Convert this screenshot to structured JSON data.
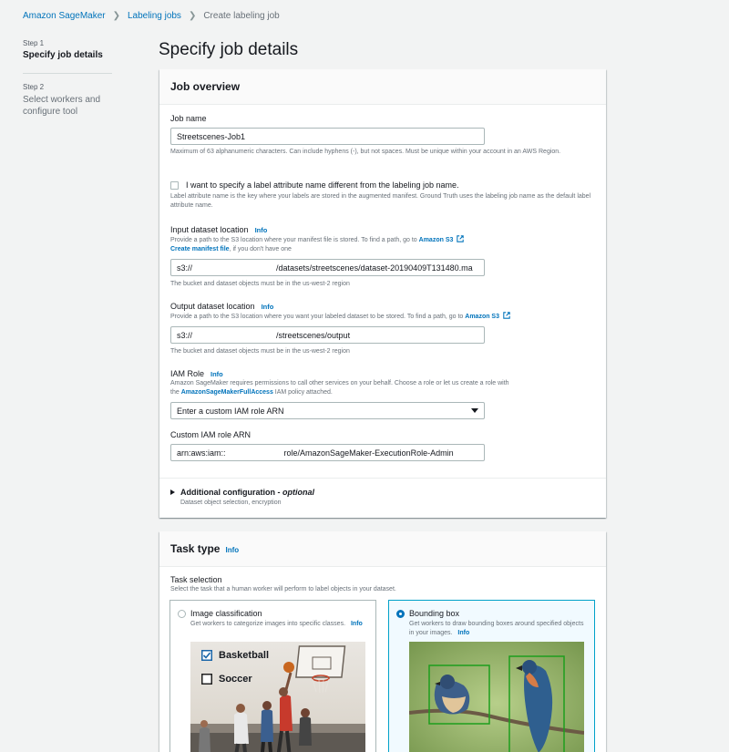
{
  "breadcrumb": {
    "item1": "Amazon SageMaker",
    "item2": "Labeling jobs",
    "current": "Create labeling job"
  },
  "steps": [
    {
      "label": "Step 1",
      "title": "Specify job details"
    },
    {
      "label": "Step 2",
      "title": "Select workers and configure tool"
    }
  ],
  "page_title": "Specify job details",
  "job_overview": {
    "title": "Job overview",
    "job_name": {
      "label": "Job name",
      "value": "Streetscenes-Job1",
      "hint": "Maximum of 63 alphanumeric characters. Can include hyphens (-), but not spaces. Must be unique within your account in an AWS Region."
    },
    "label_attr": {
      "label": "I want to specify a label attribute name different from the labeling job name.",
      "hint": "Label attribute name is the key where your labels are stored in the augmented manifest. Ground Truth uses the labeling job name as the default label attribute name."
    },
    "input": {
      "label": "Input dataset location",
      "info": "Info",
      "desc_prefix": "Provide a path to the S3 location where your manifest file is stored. To find a path, go to",
      "desc_link": "Amazon S3",
      "manifest_link": "Create manifest file",
      "manifest_suffix": ", if you don't have one",
      "value_prefix": "s3://",
      "value_suffix": "/datasets/streetscenes/dataset-20190409T131480.ma",
      "hint": "The bucket and dataset objects must be in the us-west-2 region"
    },
    "output": {
      "label": "Output dataset location",
      "info": "Info",
      "desc_prefix": "Provide a path to the S3 location where you want your labeled dataset to be stored. To find a path, go to",
      "desc_link": "Amazon S3",
      "value_prefix": "s3://",
      "value_suffix": "/streetscenes/output",
      "hint": "The bucket and dataset objects must be in the us-west-2 region"
    },
    "iam": {
      "label": "IAM Role",
      "info": "Info",
      "desc1": "Amazon SageMaker requires permissions to call other services on your behalf. Choose a role or let us create a role with",
      "desc_the": "the",
      "desc_link": "AmazonSageMakerFullAccess",
      "desc2": "IAM policy attached.",
      "selected": "Enter a custom IAM role ARN"
    },
    "custom_iam": {
      "label": "Custom IAM role ARN",
      "value_prefix": "arn:aws:iam::",
      "value_suffix": "role/AmazonSageMaker-ExecutionRole-Admin"
    },
    "additional": {
      "title": "Additional configuration -",
      "optional": "optional",
      "desc": "Dataset object selection, encryption"
    }
  },
  "task_type": {
    "title": "Task type",
    "info": "Info",
    "selection_label": "Task selection",
    "selection_desc": "Select the task that a human worker will perform to label objects in your dataset.",
    "tiles": [
      {
        "title": "Image classification",
        "desc": "Get workers to categorize images into specific classes.",
        "info": "Info",
        "selected": false,
        "checks": [
          "Basketball",
          "Soccer"
        ]
      },
      {
        "title": "Bounding box",
        "desc": "Get workers to draw bounding boxes around specified objects in your images.",
        "info": "Info",
        "selected": true
      }
    ]
  },
  "colors": {
    "link": "#0073bb",
    "accent": "#00a1c9",
    "bbox": "#1d9e1d"
  }
}
